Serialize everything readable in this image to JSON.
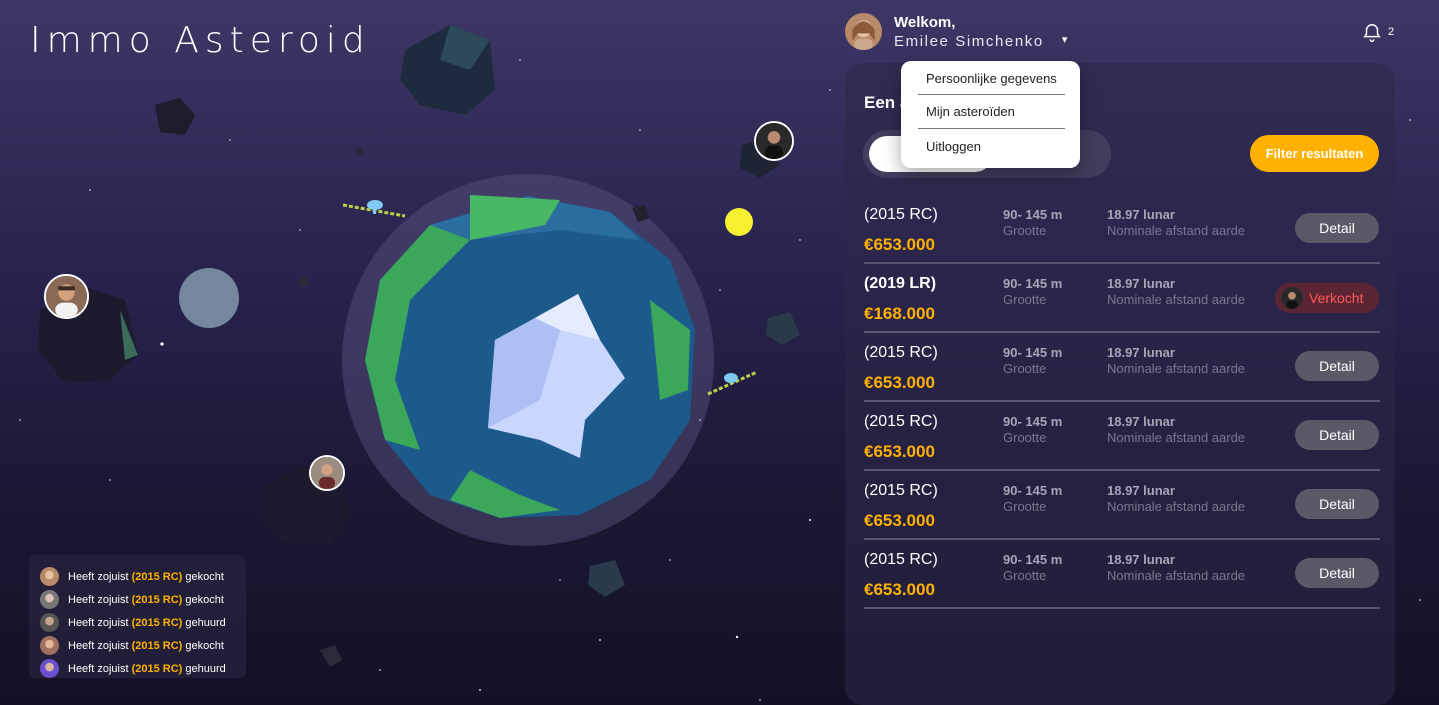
{
  "brand": "Immo Asteroid",
  "user": {
    "welcome": "Welkom,",
    "name": "Emilee Simchenko",
    "caret": "▾"
  },
  "notifications": {
    "icon": "bell-icon",
    "count": "2"
  },
  "dropdown": {
    "items": [
      "Persoonlijke gegevens",
      "Mijn asteroïden",
      "Uitloggen"
    ]
  },
  "panel": {
    "title": "Een a",
    "filter_label": "Filter resultaten",
    "rows": [
      {
        "code": "(2015 RC)",
        "price": "€653.000",
        "size": "90- 145 m",
        "size_label": "Grootte",
        "distance": "18.97 lunar",
        "distance_label": "Nominale afstand aarde",
        "action": "Detail",
        "sold": false
      },
      {
        "code": "(2019 LR)",
        "price": "€168.000",
        "size": "90- 145 m",
        "size_label": "Grootte",
        "distance": "18.97 lunar",
        "distance_label": "Nominale afstand aarde",
        "action": "Verkocht",
        "sold": true
      },
      {
        "code": "(2015 RC)",
        "price": "€653.000",
        "size": "90- 145 m",
        "size_label": "Grootte",
        "distance": "18.97 lunar",
        "distance_label": "Nominale afstand aarde",
        "action": "Detail",
        "sold": false
      },
      {
        "code": "(2015 RC)",
        "price": "€653.000",
        "size": "90- 145 m",
        "size_label": "Grootte",
        "distance": "18.97 lunar",
        "distance_label": "Nominale afstand aarde",
        "action": "Detail",
        "sold": false
      },
      {
        "code": "(2015 RC)",
        "price": "€653.000",
        "size": "90- 145 m",
        "size_label": "Grootte",
        "distance": "18.97 lunar",
        "distance_label": "Nominale afstand aarde",
        "action": "Detail",
        "sold": false
      },
      {
        "code": "(2015 RC)",
        "price": "€653.000",
        "size": "90- 145 m",
        "size_label": "Grootte",
        "distance": "18.97 lunar",
        "distance_label": "Nominale afstand aarde",
        "action": "Detail",
        "sold": false
      }
    ]
  },
  "feed": [
    {
      "prefix": "Heeft zojuist",
      "code": "(2015 RC)",
      "verb": "gekocht"
    },
    {
      "prefix": "Heeft zojuist",
      "code": "(2015 RC)",
      "verb": "gekocht"
    },
    {
      "prefix": "Heeft zojuist",
      "code": "(2015 RC)",
      "verb": "gehuurd"
    },
    {
      "prefix": "Heeft zojuist",
      "code": "(2015 RC)",
      "verb": "gekocht"
    },
    {
      "prefix": "Heeft zojuist",
      "code": "(2015 RC)",
      "verb": "gehuurd"
    }
  ],
  "colors": {
    "accent": "#ffb100",
    "sold_text": "#ff5a5a",
    "ocean": "#1d5a8c",
    "land": "#3aa75a",
    "ice": "#c9d7ff"
  }
}
